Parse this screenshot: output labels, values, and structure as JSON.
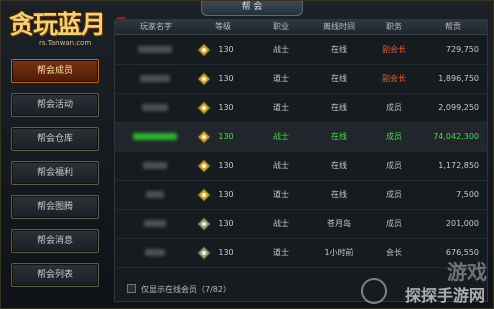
{
  "logo": {
    "title": "贪玩蓝月",
    "subtitle": "rs.Tanwan.com"
  },
  "window": {
    "title": "帮 会"
  },
  "sidebar": {
    "items": [
      {
        "label": "帮会成员",
        "active": true
      },
      {
        "label": "帮会活动"
      },
      {
        "label": "帮会仓库"
      },
      {
        "label": "帮会福利"
      },
      {
        "label": "帮会图腾"
      },
      {
        "label": "帮会消息"
      },
      {
        "label": "帮会列表"
      }
    ]
  },
  "table": {
    "headers": [
      "玩家名字",
      "等级",
      "职业",
      "离线时间",
      "职务",
      "帮贡"
    ],
    "rows": [
      {
        "level": "130",
        "class": "战士",
        "status": "在线",
        "role": "副会长",
        "contribution": "729,750",
        "highlight": "none"
      },
      {
        "level": "130",
        "class": "道士",
        "status": "在线",
        "role": "副会长",
        "contribution": "1,896,750",
        "highlight": "none"
      },
      {
        "level": "130",
        "class": "道士",
        "status": "在线",
        "role": "成员",
        "contribution": "2,099,250",
        "highlight": "none"
      },
      {
        "level": "130",
        "class": "战士",
        "status": "在线",
        "role": "成员",
        "contribution": "74,042,300",
        "highlight": "green"
      },
      {
        "level": "130",
        "class": "战士",
        "status": "在线",
        "role": "成员",
        "contribution": "1,172,850",
        "highlight": "none"
      },
      {
        "level": "130",
        "class": "道士",
        "status": "在线",
        "role": "成员",
        "contribution": "7,500",
        "highlight": "none"
      },
      {
        "level": "130",
        "class": "战士",
        "status": "苍月岛",
        "role": "成员",
        "contribution": "201,000",
        "highlight": "none"
      },
      {
        "level": "130",
        "class": "道士",
        "status": "1小时前",
        "role": "会长",
        "contribution": "676,550",
        "highlight": "none"
      }
    ]
  },
  "footer": {
    "checkbox_label": "仅显示在线会员（7/82）"
  },
  "watermark": {
    "line1": "游戏",
    "line2": "探探手游网"
  }
}
